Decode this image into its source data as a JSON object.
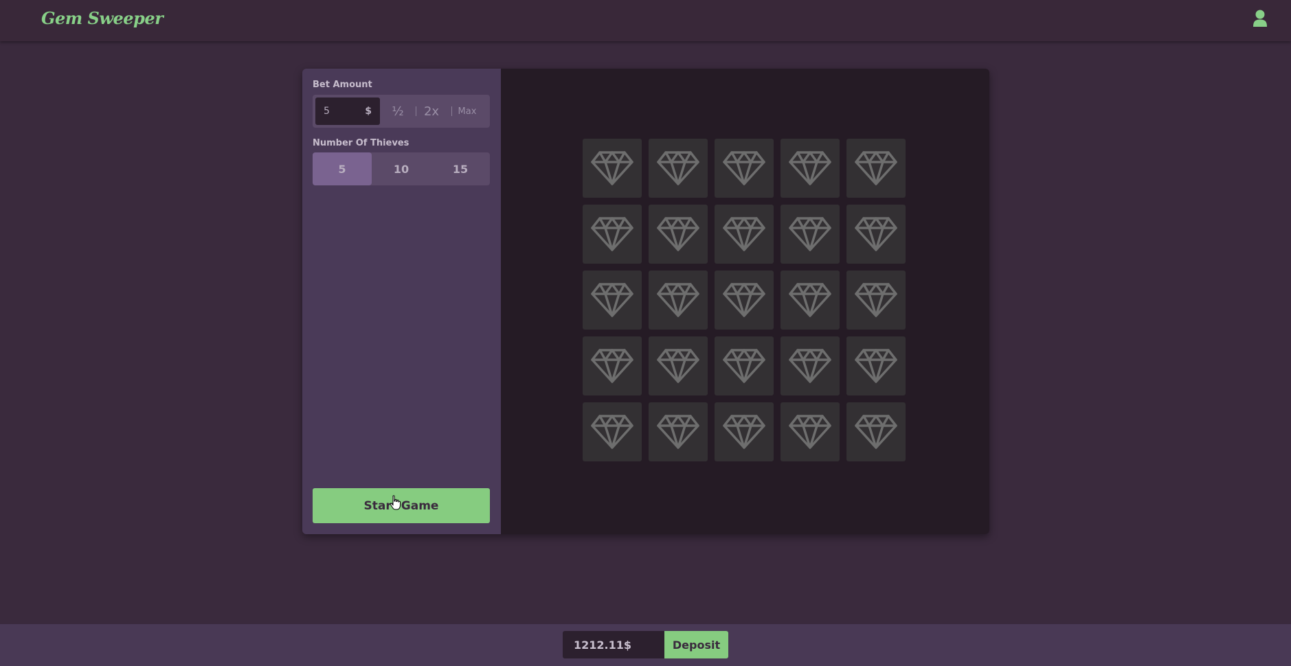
{
  "header": {
    "logo": "Gem Sweeper",
    "user_icon": "user-icon",
    "accent_color": "#88d088"
  },
  "sidebar": {
    "bet_label": "Bet Amount",
    "bet_value": "5",
    "bet_currency": "$",
    "half_label": "½",
    "double_label": "2x",
    "max_label": "Max",
    "thieves_label": "Number Of Thieves",
    "thieves_options": [
      "5",
      "10",
      "15"
    ],
    "thieves_selected": "5",
    "start_label": "Start Game"
  },
  "board": {
    "rows": 5,
    "cols": 5,
    "tile_icon": "diamond-icon"
  },
  "footer": {
    "balance": "1212.11$",
    "deposit_label": "Deposit"
  }
}
